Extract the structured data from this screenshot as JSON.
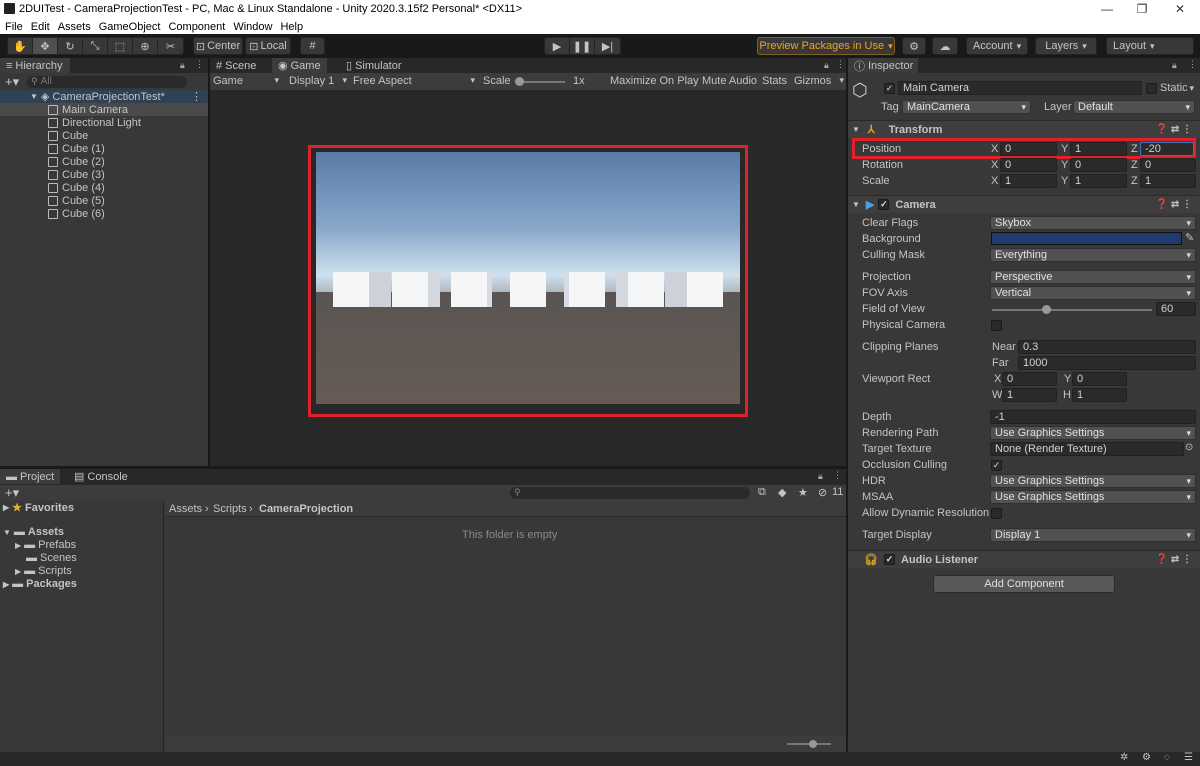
{
  "window": {
    "title": "2DUITest - CameraProjectionTest - PC, Mac & Linux Standalone - Unity 2020.3.15f2 Personal* <DX11>"
  },
  "menu": [
    "File",
    "Edit",
    "Assets",
    "GameObject",
    "Component",
    "Window",
    "Help"
  ],
  "toolbar": {
    "pivot": "Center",
    "space": "Local",
    "preview_packages": "Preview Packages in Use",
    "account": "Account",
    "layers": "Layers",
    "layout": "Layout"
  },
  "hierarchy": {
    "tab": "Hierarchy",
    "search_placeholder": "All",
    "scene": "CameraProjectionTest*",
    "items": [
      "Main Camera",
      "Directional Light",
      "Cube",
      "Cube (1)",
      "Cube (2)",
      "Cube (3)",
      "Cube (4)",
      "Cube (5)",
      "Cube (6)"
    ]
  },
  "game": {
    "tabs": [
      "Scene",
      "Game",
      "Simulator"
    ],
    "mode": "Game",
    "display": "Display 1",
    "aspect": "Free Aspect",
    "scale_label": "Scale",
    "scale_value": "1x",
    "buttons": [
      "Maximize On Play",
      "Mute Audio",
      "Stats",
      "Gizmos"
    ]
  },
  "project": {
    "tabs": [
      "Project",
      "Console"
    ],
    "favorites": "Favorites",
    "assets": "Assets",
    "asset_children": [
      "Prefabs",
      "Scenes",
      "Scripts"
    ],
    "packages": "Packages",
    "breadcrumb": [
      "Assets",
      "Scripts",
      "CameraProjection"
    ],
    "empty": "This folder is empty",
    "hidden_count": "11"
  },
  "inspector": {
    "tab": "Inspector",
    "name": "Main Camera",
    "static": "Static",
    "tag_label": "Tag",
    "tag": "MainCamera",
    "layer_label": "Layer",
    "layer": "Default",
    "transform": {
      "title": "Transform",
      "position": {
        "label": "Position",
        "x": "0",
        "y": "1",
        "z": "-20"
      },
      "rotation": {
        "label": "Rotation",
        "x": "0",
        "y": "0",
        "z": "0"
      },
      "scale": {
        "label": "Scale",
        "x": "1",
        "y": "1",
        "z": "1"
      }
    },
    "camera": {
      "title": "Camera",
      "clear_flags_label": "Clear Flags",
      "clear_flags": "Skybox",
      "background_label": "Background",
      "background_color": "#1f3a6e",
      "culling_mask_label": "Culling Mask",
      "culling_mask": "Everything",
      "projection_label": "Projection",
      "projection": "Perspective",
      "fov_axis_label": "FOV Axis",
      "fov_axis": "Vertical",
      "fov_label": "Field of View",
      "fov": "60",
      "physical_label": "Physical Camera",
      "clipping_label": "Clipping Planes",
      "near_label": "Near",
      "near": "0.3",
      "far_label": "Far",
      "far": "1000",
      "viewport_label": "Viewport Rect",
      "vx": "0",
      "vy": "0",
      "vw": "1",
      "vh": "1",
      "depth_label": "Depth",
      "depth": "-1",
      "render_path_label": "Rendering Path",
      "render_path": "Use Graphics Settings",
      "target_tex_label": "Target Texture",
      "target_tex": "None (Render Texture)",
      "occlusion_label": "Occlusion Culling",
      "hdr_label": "HDR",
      "hdr": "Use Graphics Settings",
      "msaa_label": "MSAA",
      "msaa": "Use Graphics Settings",
      "dyn_res_label": "Allow Dynamic Resolution",
      "target_display_label": "Target Display",
      "target_display": "Display 1"
    },
    "audio_listener": "Audio Listener",
    "add_component": "Add Component"
  },
  "colors": {
    "highlight": "#e0202a",
    "selection": "#2c5d87"
  }
}
